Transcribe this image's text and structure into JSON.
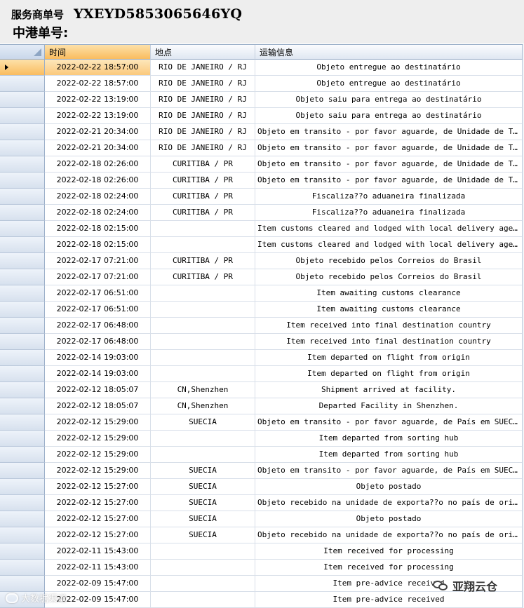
{
  "header": {
    "provider_label": "服务商单号",
    "provider_number": "YXEYD5853065646YQ",
    "hk_label": "中港单号:"
  },
  "columns": {
    "time": "时间",
    "location": "地点",
    "info": "运输信息"
  },
  "rows": [
    {
      "time": "2022-02-22 18:57:00",
      "location": "RIO DE JANEIRO / RJ",
      "info": "Objeto entregue ao destinatário"
    },
    {
      "time": "2022-02-22 18:57:00",
      "location": "RIO DE JANEIRO / RJ",
      "info": "Objeto entregue ao destinatário"
    },
    {
      "time": "2022-02-22 13:19:00",
      "location": "RIO DE JANEIRO / RJ",
      "info": "Objeto saiu para entrega ao destinatário"
    },
    {
      "time": "2022-02-22 13:19:00",
      "location": "RIO DE JANEIRO / RJ",
      "info": "Objeto saiu para entrega ao destinatário"
    },
    {
      "time": "2022-02-21 20:34:00",
      "location": "RIO DE JANEIRO / RJ",
      "info": "Objeto em transito - por favor aguarde, de Unidade de Trat…"
    },
    {
      "time": "2022-02-21 20:34:00",
      "location": "RIO DE JANEIRO / RJ",
      "info": "Objeto em transito - por favor aguarde, de Unidade de Trat…"
    },
    {
      "time": "2022-02-18 02:26:00",
      "location": "CURITIBA / PR",
      "info": "Objeto em transito - por favor aguarde, de Unidade de Trat…"
    },
    {
      "time": "2022-02-18 02:26:00",
      "location": "CURITIBA / PR",
      "info": "Objeto em transito - por favor aguarde, de Unidade de Trat…"
    },
    {
      "time": "2022-02-18 02:24:00",
      "location": "CURITIBA / PR",
      "info": "Fiscaliza??o aduaneira finalizada"
    },
    {
      "time": "2022-02-18 02:24:00",
      "location": "CURITIBA / PR",
      "info": "Fiscaliza??o aduaneira finalizada"
    },
    {
      "time": "2022-02-18 02:15:00",
      "location": "",
      "info": "Item customs cleared and lodged with local delivery agent"
    },
    {
      "time": "2022-02-18 02:15:00",
      "location": "",
      "info": "Item customs cleared and lodged with local delivery agent"
    },
    {
      "time": "2022-02-17 07:21:00",
      "location": "CURITIBA / PR",
      "info": "Objeto recebido pelos Correios do Brasil"
    },
    {
      "time": "2022-02-17 07:21:00",
      "location": "CURITIBA / PR",
      "info": "Objeto recebido pelos Correios do Brasil"
    },
    {
      "time": "2022-02-17 06:51:00",
      "location": "",
      "info": "Item awaiting customs clearance"
    },
    {
      "time": "2022-02-17 06:51:00",
      "location": "",
      "info": "Item awaiting customs clearance"
    },
    {
      "time": "2022-02-17 06:48:00",
      "location": "",
      "info": "Item received into final destination country"
    },
    {
      "time": "2022-02-17 06:48:00",
      "location": "",
      "info": "Item received into final destination country"
    },
    {
      "time": "2022-02-14 19:03:00",
      "location": "",
      "info": "Item departed on flight from origin"
    },
    {
      "time": "2022-02-14 19:03:00",
      "location": "",
      "info": "Item departed on flight from origin"
    },
    {
      "time": "2022-02-12 18:05:07",
      "location": "CN,Shenzhen",
      "info": "Shipment arrived at facility."
    },
    {
      "time": "2022-02-12 18:05:07",
      "location": "CN,Shenzhen",
      "info": "Departed Facility in Shenzhen."
    },
    {
      "time": "2022-02-12 15:29:00",
      "location": "SUECIA",
      "info": "Objeto em transito - por favor aguarde, de País em SUECIA…"
    },
    {
      "time": "2022-02-12 15:29:00",
      "location": "",
      "info": "Item departed from sorting hub"
    },
    {
      "time": "2022-02-12 15:29:00",
      "location": "",
      "info": "Item departed from sorting hub"
    },
    {
      "time": "2022-02-12 15:29:00",
      "location": "SUECIA",
      "info": "Objeto em transito - por favor aguarde, de País em SUECIA…"
    },
    {
      "time": "2022-02-12 15:27:00",
      "location": "SUECIA",
      "info": "Objeto postado"
    },
    {
      "time": "2022-02-12 15:27:00",
      "location": "SUECIA",
      "info": "Objeto recebido na unidade de exporta??o no país de origem"
    },
    {
      "time": "2022-02-12 15:27:00",
      "location": "SUECIA",
      "info": "Objeto postado"
    },
    {
      "time": "2022-02-12 15:27:00",
      "location": "SUECIA",
      "info": "Objeto recebido na unidade de exporta??o no país de origem"
    },
    {
      "time": "2022-02-11 15:43:00",
      "location": "",
      "info": "Item received for processing"
    },
    {
      "time": "2022-02-11 15:43:00",
      "location": "",
      "info": "Item received for processing"
    },
    {
      "time": "2022-02-09 15:47:00",
      "location": "",
      "info": "Item pre-advice received"
    },
    {
      "time": "2022-02-09 15:47:00",
      "location": "",
      "info": "Item pre-advice received"
    }
  ],
  "watermark": "大数据渠道",
  "brand": "亚翔云仓",
  "icons": {
    "current_row": "row-pointer-icon",
    "brand": "chat-bubbles-icon"
  },
  "colors": {
    "selection": "#f9bc5f",
    "header_bg": "#eeeeee",
    "grid_header": "#dfe7f2"
  }
}
